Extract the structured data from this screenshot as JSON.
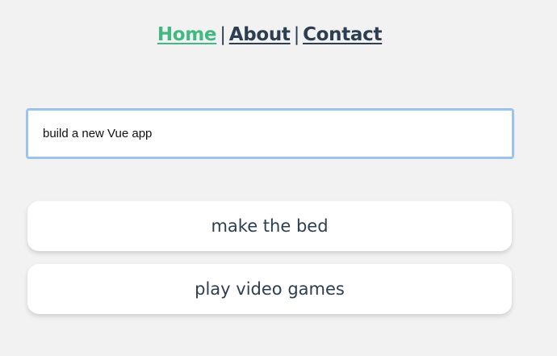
{
  "nav": {
    "links": [
      {
        "label": "Home",
        "active": true
      },
      {
        "label": "About",
        "active": false
      },
      {
        "label": "Contact",
        "active": false
      }
    ],
    "separator": "|"
  },
  "todo_input": {
    "value": "build a new Vue app"
  },
  "todos": [
    {
      "label": "make the bed"
    },
    {
      "label": "play video games"
    }
  ],
  "colors": {
    "background": "#f2f2f2",
    "text": "#2c3e50",
    "active_link": "#42b983",
    "input_focus_border": "#9cc3ee"
  }
}
